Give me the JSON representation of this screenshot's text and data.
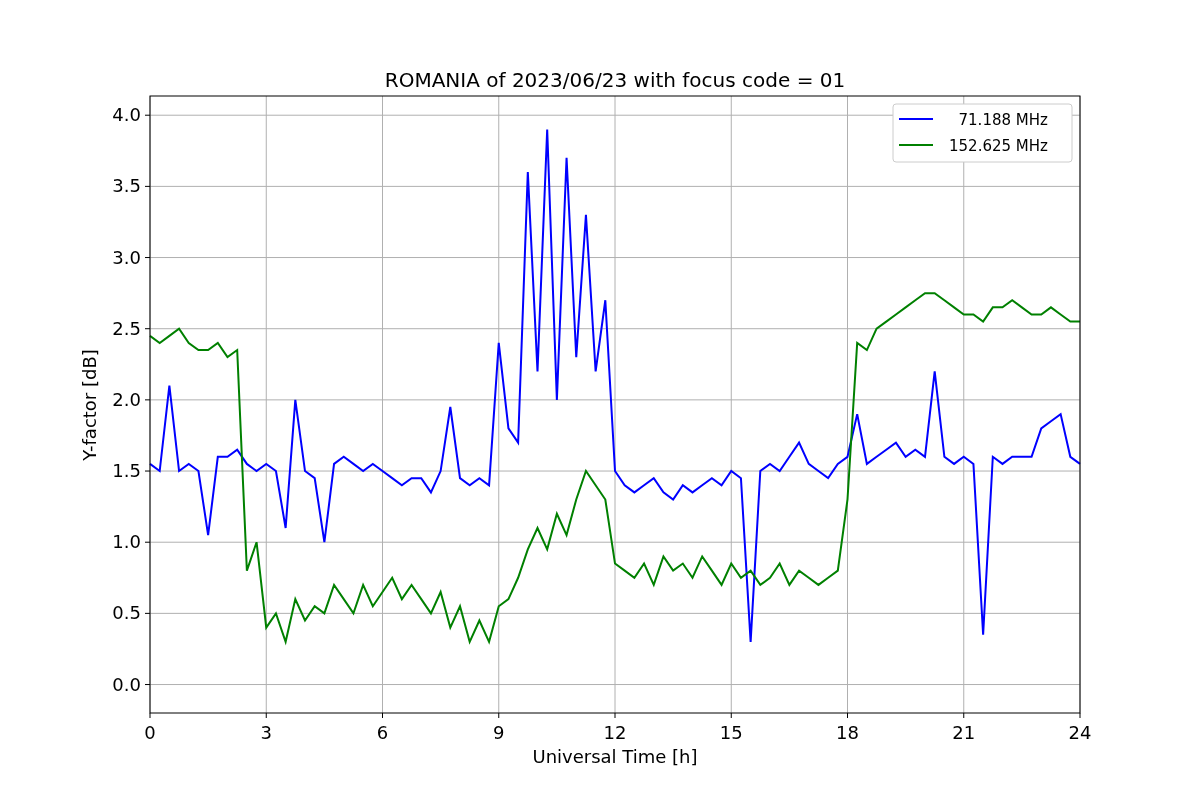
{
  "figure": {
    "chart_data": {
      "type": "line",
      "title": "ROMANIA of 2023/06/23 with focus code = 01",
      "xlabel": "Universal Time [h]",
      "ylabel": "Y-factor [dB]",
      "x": [
        0,
        0.25,
        0.5,
        0.75,
        1,
        1.25,
        1.5,
        1.75,
        2,
        2.25,
        2.5,
        2.75,
        3,
        3.25,
        3.5,
        3.75,
        4,
        4.25,
        4.5,
        4.75,
        5,
        5.25,
        5.5,
        5.75,
        6,
        6.25,
        6.5,
        6.75,
        7,
        7.25,
        7.5,
        7.75,
        8,
        8.25,
        8.5,
        8.75,
        9,
        9.25,
        9.5,
        9.75,
        10,
        10.25,
        10.5,
        10.75,
        11,
        11.25,
        11.5,
        11.75,
        12,
        12.25,
        12.5,
        12.75,
        13,
        13.25,
        13.5,
        13.75,
        14,
        14.25,
        14.5,
        14.75,
        15,
        15.25,
        15.5,
        15.75,
        16,
        16.25,
        16.5,
        16.75,
        17,
        17.25,
        17.5,
        17.75,
        18,
        18.25,
        18.5,
        18.75,
        19,
        19.25,
        19.5,
        19.75,
        20,
        20.25,
        20.5,
        20.75,
        21,
        21.25,
        21.5,
        21.75,
        22,
        22.25,
        22.5,
        22.75,
        23,
        23.25,
        23.5,
        23.75,
        24
      ],
      "series": [
        {
          "name": "  71.188 MHz",
          "color": "#0000ff",
          "values": [
            1.55,
            1.5,
            2.1,
            1.5,
            1.55,
            1.5,
            1.05,
            1.6,
            1.6,
            1.65,
            1.55,
            1.5,
            1.55,
            1.5,
            1.1,
            2.0,
            1.5,
            1.45,
            1.0,
            1.55,
            1.6,
            1.55,
            1.5,
            1.55,
            1.5,
            1.45,
            1.4,
            1.45,
            1.45,
            1.35,
            1.5,
            1.95,
            1.45,
            1.4,
            1.45,
            1.4,
            2.4,
            1.8,
            1.7,
            3.6,
            2.2,
            3.9,
            2.0,
            3.7,
            2.3,
            3.3,
            2.2,
            2.7,
            1.5,
            1.4,
            1.35,
            1.4,
            1.45,
            1.35,
            1.3,
            1.4,
            1.35,
            1.4,
            1.45,
            1.4,
            1.5,
            1.45,
            0.3,
            1.5,
            1.55,
            1.5,
            1.6,
            1.7,
            1.55,
            1.5,
            1.45,
            1.55,
            1.6,
            1.9,
            1.55,
            1.6,
            1.65,
            1.7,
            1.6,
            1.65,
            1.6,
            2.2,
            1.6,
            1.55,
            1.6,
            1.55,
            0.35,
            1.6,
            1.55,
            1.6,
            1.6,
            1.6,
            1.8,
            1.85,
            1.9,
            1.6,
            1.55
          ]
        },
        {
          "name": "152.625 MHz",
          "color": "#008000",
          "values": [
            2.45,
            2.4,
            2.45,
            2.5,
            2.4,
            2.35,
            2.35,
            2.4,
            2.3,
            2.35,
            0.8,
            1.0,
            0.4,
            0.5,
            0.3,
            0.6,
            0.45,
            0.55,
            0.5,
            0.7,
            0.6,
            0.5,
            0.7,
            0.55,
            0.65,
            0.75,
            0.6,
            0.7,
            0.6,
            0.5,
            0.65,
            0.4,
            0.55,
            0.3,
            0.45,
            0.3,
            0.55,
            0.6,
            0.75,
            0.95,
            1.1,
            0.95,
            1.2,
            1.05,
            1.3,
            1.5,
            1.4,
            1.3,
            0.85,
            0.8,
            0.75,
            0.85,
            0.7,
            0.9,
            0.8,
            0.85,
            0.75,
            0.9,
            0.8,
            0.7,
            0.85,
            0.75,
            0.8,
            0.7,
            0.75,
            0.85,
            0.7,
            0.8,
            0.75,
            0.7,
            0.75,
            0.8,
            1.3,
            2.4,
            2.35,
            2.5,
            2.55,
            2.6,
            2.65,
            2.7,
            2.75,
            2.75,
            2.7,
            2.65,
            2.6,
            2.6,
            2.55,
            2.65,
            2.65,
            2.7,
            2.65,
            2.6,
            2.6,
            2.65,
            2.6,
            2.55,
            2.55
          ]
        }
      ],
      "grid": true,
      "legend": true,
      "xlim": [
        0,
        24
      ],
      "ylim": [
        -0.2,
        4.135
      ],
      "xticks": [
        0,
        3,
        6,
        9,
        12,
        15,
        18,
        21,
        24
      ],
      "yticks": [
        {
          "value": 0,
          "label": "0.0"
        },
        {
          "value": 0.5,
          "label": "0.5"
        },
        {
          "value": 1,
          "label": "1.0"
        },
        {
          "value": 1.5,
          "label": "1.5"
        },
        {
          "value": 2,
          "label": "2.0"
        },
        {
          "value": 2.5,
          "label": "2.5"
        },
        {
          "value": 3,
          "label": "3.0"
        },
        {
          "value": 3.5,
          "label": "3.5"
        },
        {
          "value": 4,
          "label": "4.0"
        }
      ]
    }
  }
}
